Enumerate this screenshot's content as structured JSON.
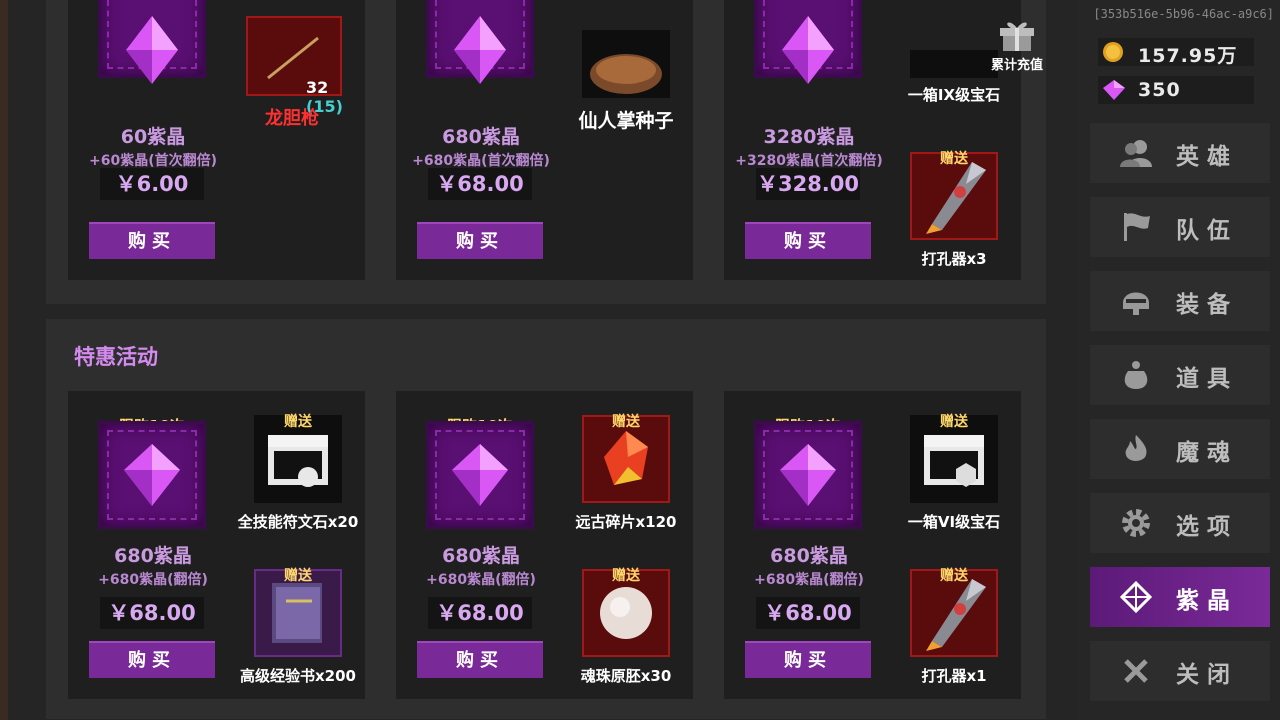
{
  "uid": "[353b516e-5b96-46ac-a9c6]",
  "resources": {
    "gold": "157.95万",
    "crystal": "350"
  },
  "gift_button": {
    "label": "累计充值"
  },
  "nav": [
    {
      "label": "英雄",
      "icon": "heroes-icon"
    },
    {
      "label": "队伍",
      "icon": "flag-icon"
    },
    {
      "label": "装备",
      "icon": "helmet-icon"
    },
    {
      "label": "道具",
      "icon": "bag-icon"
    },
    {
      "label": "魔魂",
      "icon": "flame-icon"
    },
    {
      "label": "选项",
      "icon": "gear-icon"
    },
    {
      "label": "紫晶",
      "icon": "crystal-icon",
      "active": true
    },
    {
      "label": "关闭",
      "icon": "close-icon"
    }
  ],
  "top_section": {
    "cards": [
      {
        "name": "60紫晶",
        "bonus": "+60紫晶(首次翻倍)",
        "price": "￥6.00",
        "buy": "购买",
        "reward": {
          "name": "龙胆枪",
          "count": "32",
          "count_extra": "(15)"
        }
      },
      {
        "name": "680紫晶",
        "bonus": "+680紫晶(首次翻倍)",
        "price": "￥68.00",
        "buy": "购买",
        "reward": {
          "name": "仙人掌种子"
        }
      },
      {
        "name": "3280紫晶",
        "bonus": "+3280紫晶(首次翻倍)",
        "price": "￥328.00",
        "buy": "购买",
        "rewards": [
          {
            "name": "一箱IX级宝石"
          },
          {
            "tag": "赠送",
            "name": "打孔器x3"
          }
        ]
      }
    ]
  },
  "special_section": {
    "title": "特惠活动",
    "cards": [
      {
        "limit": "限购10次",
        "name": "680紫晶",
        "bonus": "+680紫晶(翻倍)",
        "price": "￥68.00",
        "buy": "购买",
        "rewards": [
          {
            "tag": "赠送",
            "name": "全技能符文石x20"
          },
          {
            "tag": "赠送",
            "name": "高级经验书x200"
          }
        ]
      },
      {
        "limit": "限购10次",
        "name": "680紫晶",
        "bonus": "+680紫晶(翻倍)",
        "price": "￥68.00",
        "buy": "购买",
        "rewards": [
          {
            "tag": "赠送",
            "name": "远古碎片x120"
          },
          {
            "tag": "赠送",
            "name": "魂珠原胚x30"
          }
        ]
      },
      {
        "limit": "限购10次",
        "name": "680紫晶",
        "bonus": "+680紫晶(翻倍)",
        "price": "￥68.00",
        "buy": "购买",
        "rewards": [
          {
            "tag": "赠送",
            "name": "一箱VI级宝石"
          },
          {
            "tag": "赠送",
            "name": "打孔器x1"
          }
        ]
      }
    ]
  }
}
